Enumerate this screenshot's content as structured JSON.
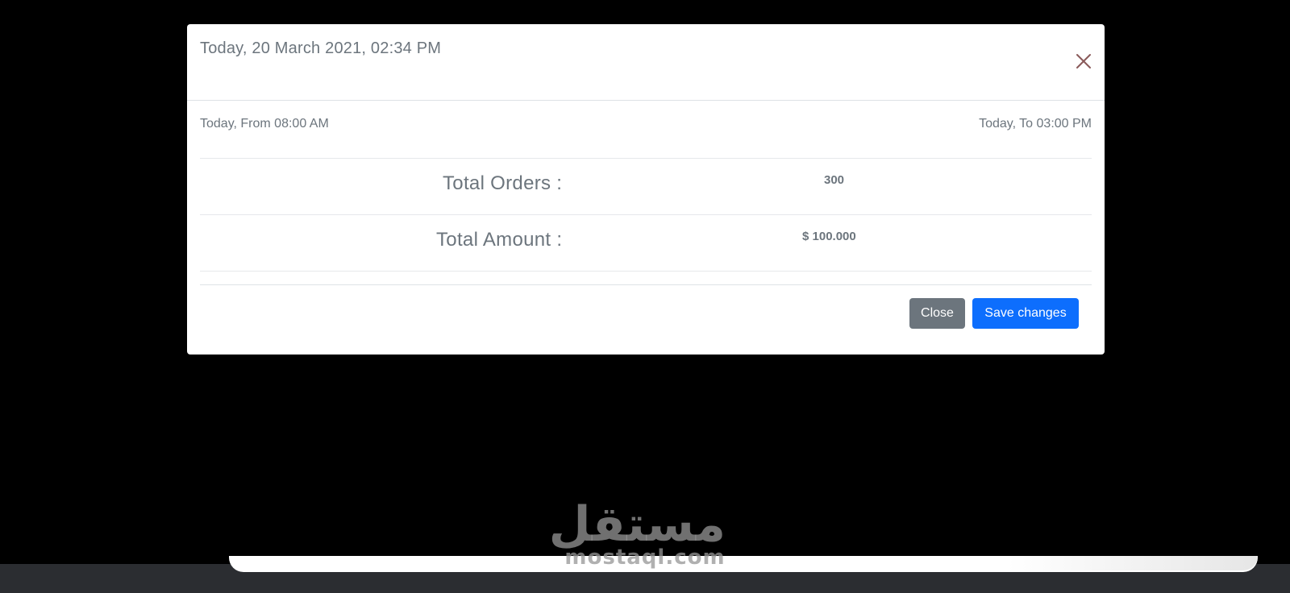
{
  "modal": {
    "title": "Today, 20 March 2021, 02:34 PM",
    "close_icon": "close-icon",
    "from_label": "Today, From 08:00 AM",
    "to_label": "Today, To 03:00 PM",
    "stats": {
      "orders_label": "Total Orders :",
      "orders_value": "300",
      "amount_label": "Total Amount :",
      "amount_value": "$ 100.000"
    },
    "footer": {
      "close_label": "Close",
      "save_label": "Save changes"
    }
  },
  "watermark": {
    "arabic": "مستقل",
    "latin": "mostaql.com"
  },
  "colors": {
    "primary": "#0d6efd",
    "secondary": "#6c757d",
    "close_icon": "#8a5a5a",
    "backdrop": "#000000"
  }
}
